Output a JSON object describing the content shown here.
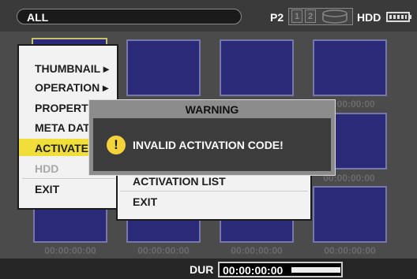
{
  "topbar": {
    "mode": "ALL",
    "p2_label": "P2",
    "slot1": "1",
    "slot2": "2",
    "hdd_label": "HDD"
  },
  "grid": {
    "timecodes": [
      "00:00:00:00",
      "00:00:00:00",
      "00:00:00:00",
      "00:00:00:00",
      "00:00:00:00",
      "00:00:00:00"
    ]
  },
  "menu": {
    "items": [
      {
        "label": "THUMBNAIL ▸"
      },
      {
        "label": "OPERATION ▸"
      },
      {
        "label": "PROPERTY"
      },
      {
        "label": "META DATA"
      },
      {
        "label": "ACTIVATE"
      },
      {
        "label": "HDD"
      },
      {
        "label": "EXIT"
      }
    ]
  },
  "submenu": {
    "items": [
      {
        "label": "ACTIVATION LIST"
      },
      {
        "label": "EXIT"
      }
    ]
  },
  "dialog": {
    "title": "WARNING",
    "icon": "warning-icon",
    "message": "INVALID ACTIVATION CODE!"
  },
  "status": {
    "dur_label": "DUR",
    "dur_value": "00:00:00:00"
  }
}
